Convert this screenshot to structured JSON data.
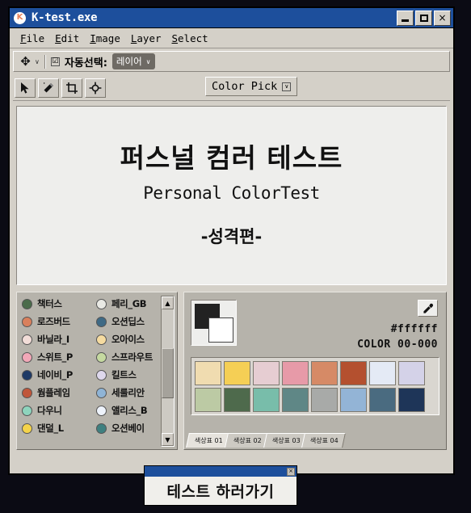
{
  "window": {
    "title": "K-test.exe",
    "logo_letter": "K",
    "controls": {
      "minimize": "minimize-button",
      "maximize": "maximize-button",
      "close": "×"
    }
  },
  "menu": {
    "items": [
      {
        "pre": "F",
        "rest": "ile"
      },
      {
        "pre": "E",
        "rest": "dit"
      },
      {
        "pre": "I",
        "rest": "mage"
      },
      {
        "pre": "L",
        "rest": "ayer"
      },
      {
        "pre": "S",
        "rest": "elect"
      }
    ]
  },
  "options_bar": {
    "move_icon": "✥",
    "caret": "∨",
    "checkbox_mark": "☑",
    "auto_select_label": "자동선택:",
    "layer_dropdown_value": "레이어",
    "layer_dropdown_caret": "∨"
  },
  "tools": [
    {
      "name": "move-arrow-tool",
      "glyph": "↖"
    },
    {
      "name": "magic-wand-tool",
      "glyph": "✦"
    },
    {
      "name": "crop-tool",
      "glyph": "⛶"
    },
    {
      "name": "target-tool",
      "glyph": "⌖"
    }
  ],
  "color_pick_button": {
    "label": "Color Pick",
    "caret": "∨"
  },
  "canvas": {
    "title": "퍼스널 컴러 테스트",
    "subtitle": "Personal ColorTest",
    "section": "-성격편-"
  },
  "color_list": {
    "left": [
      {
        "label": "책터스",
        "color": "#4a6b4a"
      },
      {
        "label": "로즈버드",
        "color": "#d9805c"
      },
      {
        "label": "바닐라_I",
        "color": "#f2ddd8"
      },
      {
        "label": "스위트_P",
        "color": "#f2a8b8"
      },
      {
        "label": "네이비_P",
        "color": "#1e3a66"
      },
      {
        "label": "웜플레임",
        "color": "#c0563a"
      },
      {
        "label": "다우니",
        "color": "#8ed4bd"
      },
      {
        "label": "댄덜_L",
        "color": "#f4d34a"
      }
    ],
    "right": [
      {
        "label": "페리_GB",
        "color": "#e9e9e4"
      },
      {
        "label": "오션딥스",
        "color": "#3f6a85"
      },
      {
        "label": "오아이스",
        "color": "#f5dba0"
      },
      {
        "label": "스프라우트",
        "color": "#c5d9a0"
      },
      {
        "label": "킬트스",
        "color": "#ded8ec"
      },
      {
        "label": "세룰리안",
        "color": "#8fb4d6"
      },
      {
        "label": "앨리스_B",
        "color": "#eef3fb"
      },
      {
        "label": "오션베이",
        "color": "#3f8080"
      }
    ]
  },
  "scrollbar": {
    "up_arrow": "▲",
    "down_arrow": "▼"
  },
  "color_panel": {
    "foreground": "#222222",
    "background": "#ffffff",
    "eyedropper_icon": "✒",
    "hex_value": "#ffffff",
    "color_id": "COLOR 00-000",
    "swatches": {
      "row1": [
        "#f0dcb0",
        "#f5cf55",
        "#e6cdd2",
        "#e79aa8",
        "#d68a66",
        "#b4502f",
        "#e4eaf5",
        "#d4d2e8"
      ],
      "row2": [
        "#bccaa4",
        "#4e6a4c",
        "#78bdaa",
        "#5f8786",
        "#a8aaa8",
        "#93b4d6",
        "#4a6b80",
        "#1e3558"
      ]
    },
    "tabs": [
      {
        "label": "색상표 01",
        "active": true
      },
      {
        "label": "색상표 02",
        "active": false
      },
      {
        "label": "색상표 03",
        "active": false
      },
      {
        "label": "색상표 04",
        "active": false
      }
    ]
  },
  "dialog": {
    "close_glyph": "×",
    "button_label": "테스트 하러가기"
  }
}
